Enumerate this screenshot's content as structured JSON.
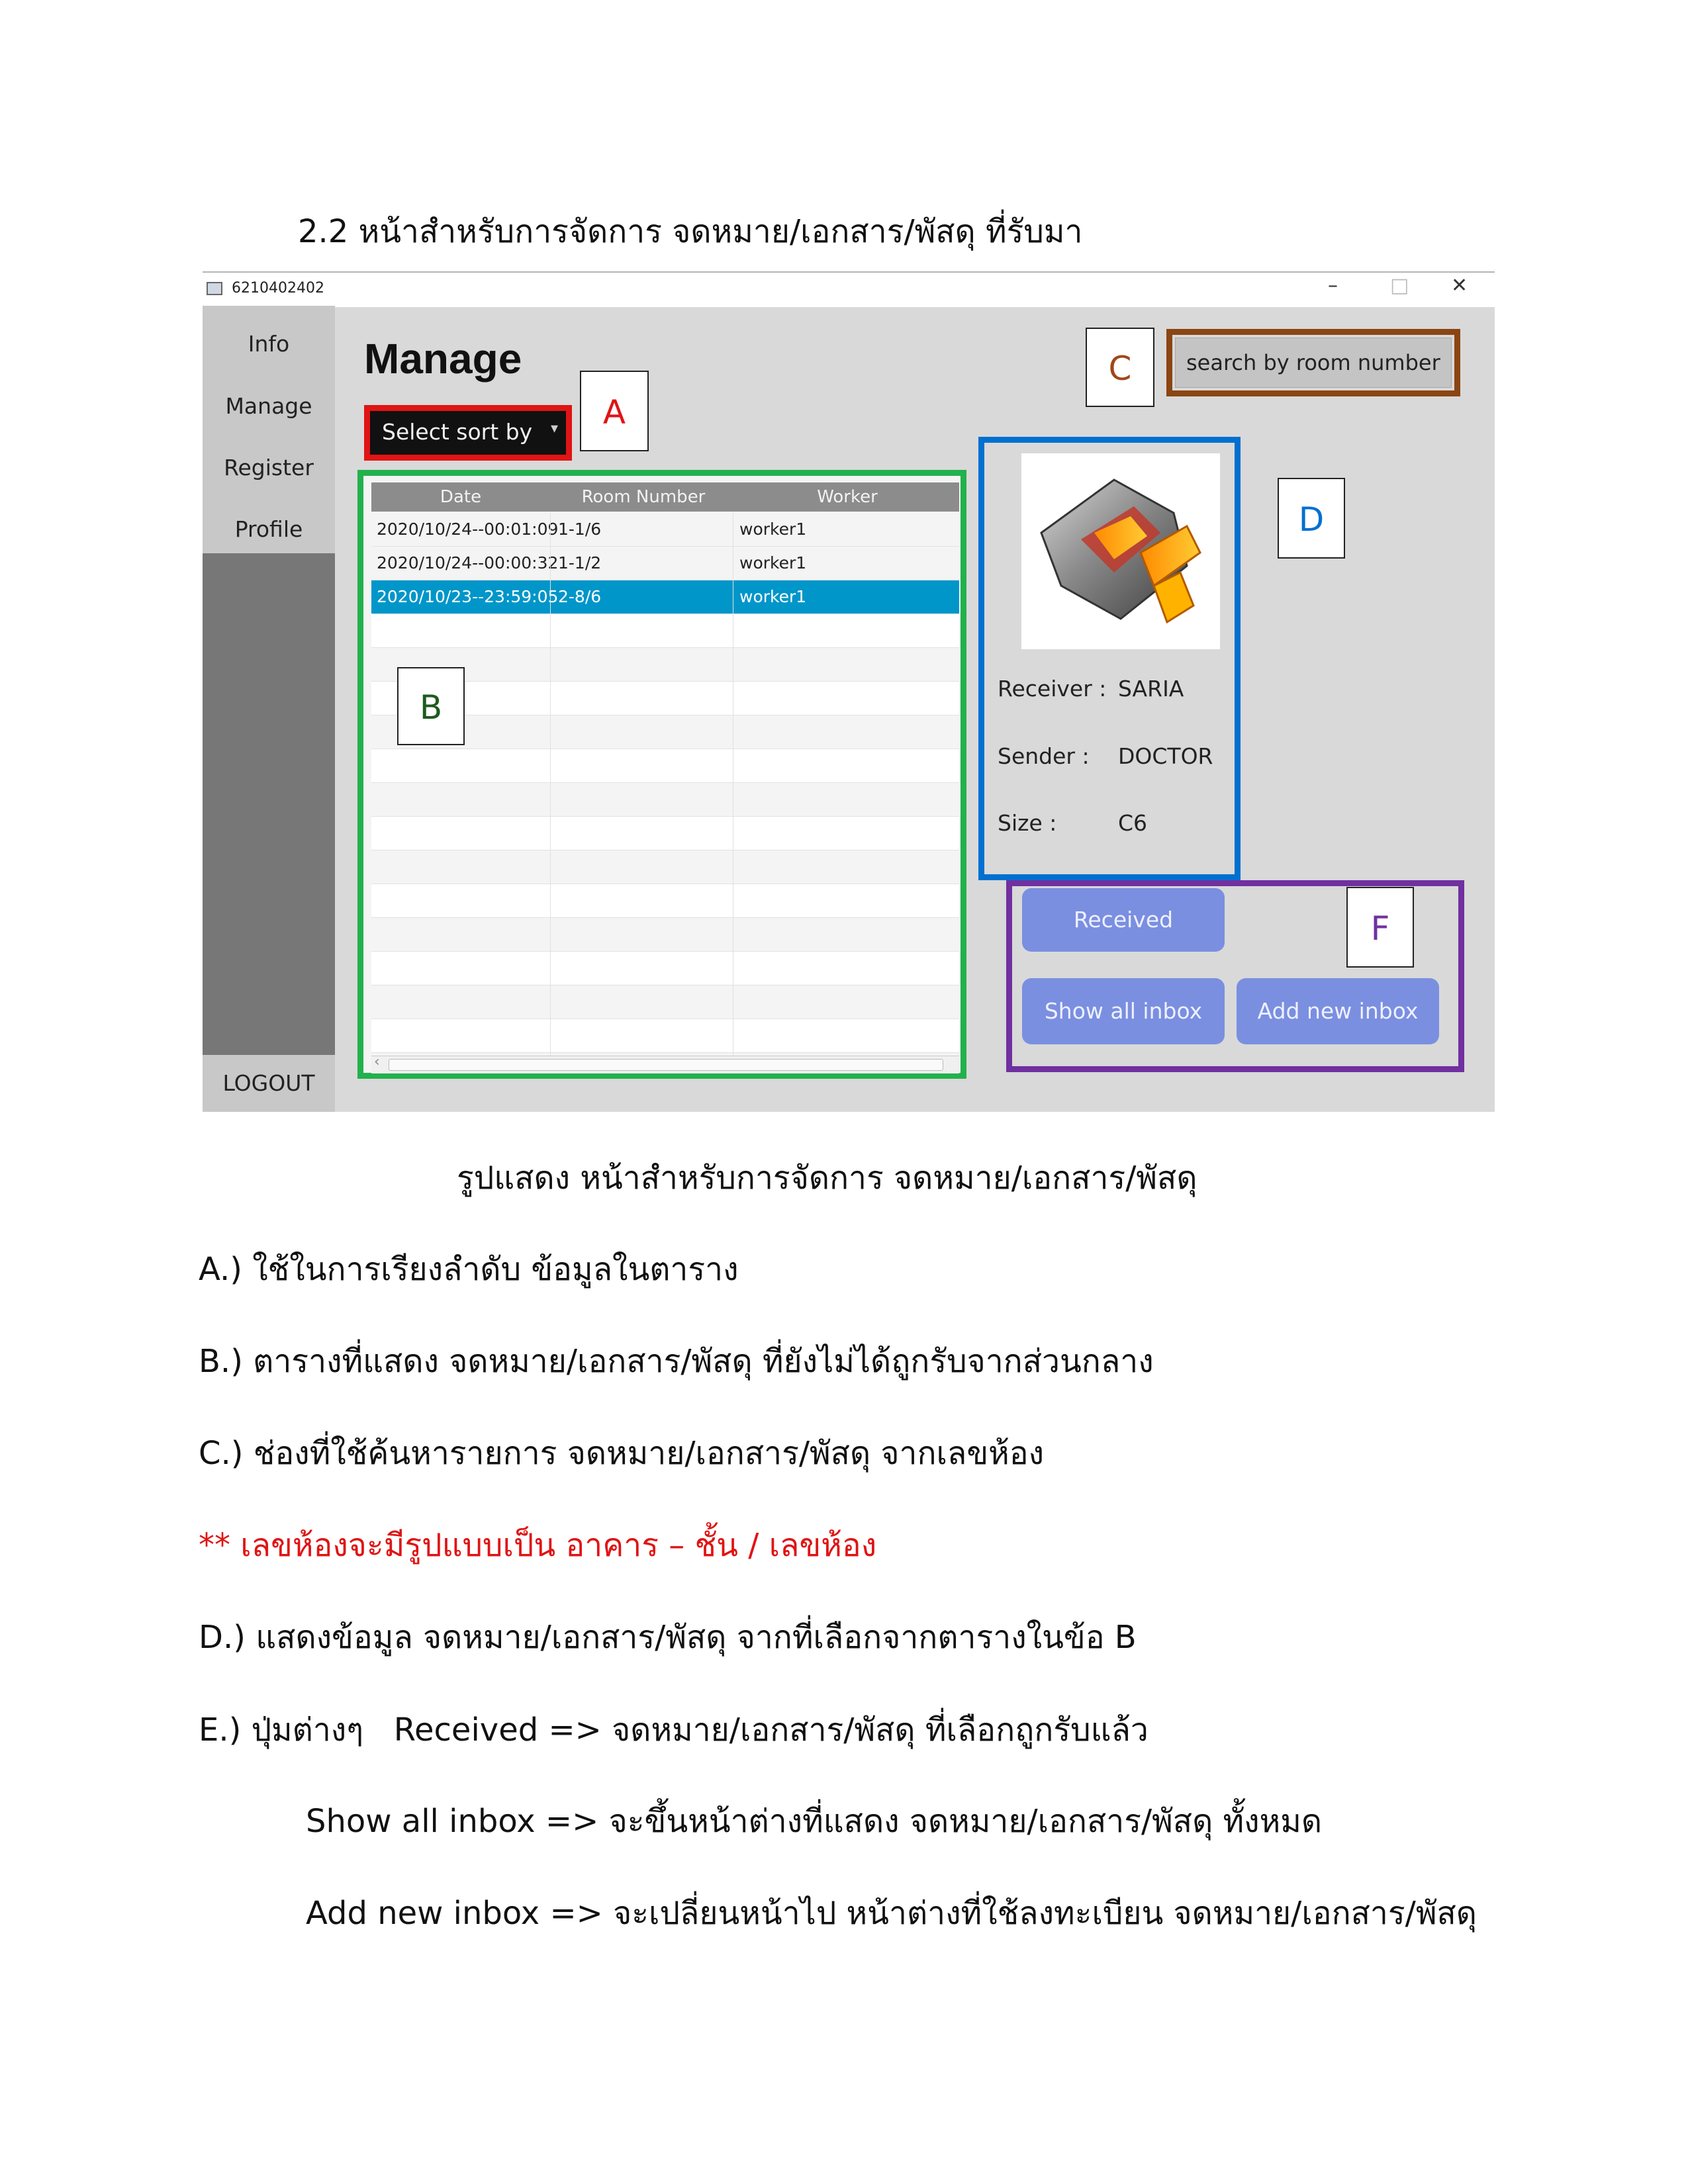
{
  "heading": "2.2 หน้าสำหรับการจัดการ จดหมาย/เอกสาร/พัสดุ ที่รับมา",
  "window": {
    "title": "6210402402",
    "controls": {
      "minimize": "–",
      "maximize": "□",
      "close": "✕"
    }
  },
  "sidebar": {
    "items": [
      {
        "label": "Info"
      },
      {
        "label": "Manage"
      },
      {
        "label": "Register"
      },
      {
        "label": "Profile"
      }
    ],
    "logout": "LOGOUT"
  },
  "main": {
    "title": "Manage",
    "sort_select": {
      "value": "Select sort by",
      "arrow": "▾"
    },
    "search": {
      "placeholder": "search by room number"
    },
    "table": {
      "columns": [
        "Date",
        "Room Number",
        "Worker"
      ],
      "rows": [
        {
          "date": "2020/10/24--00:01:09",
          "room": "1-1/6",
          "worker": "worker1",
          "selected": false
        },
        {
          "date": "2020/10/24--00:00:32",
          "room": "1-1/2",
          "worker": "worker1",
          "selected": false
        },
        {
          "date": "2020/10/23--23:59:05",
          "room": "2-8/6",
          "worker": "worker1",
          "selected": true
        }
      ],
      "scroll_left": "‹"
    },
    "details": {
      "receiver_label": "Receiver :",
      "receiver": "SARIA",
      "sender_label": "Sender :",
      "sender": "DOCTOR",
      "size_label": "Size :",
      "size": "C6"
    },
    "buttons": {
      "received": "Received",
      "show_all": "Show all inbox",
      "add_new": "Add new inbox"
    }
  },
  "callouts": {
    "a": "A",
    "b": "B",
    "c": "C",
    "d": "D",
    "f": "F"
  },
  "colors": {
    "callout_a_border": "#e01414",
    "callout_b_border": "#22b14c",
    "callout_c_border": "#8b4513",
    "callout_d_border": "#0070d0",
    "callout_f_border": "#7030a0",
    "selected_row": "#0096c9",
    "button": "#7a8fe0",
    "warning_text": "#e01414"
  },
  "caption": "รูปแสดง หน้าสำหรับการจัดการ จดหมาย/เอกสาร/พัสดุ",
  "notes": [
    "A.) ใช้ในการเรียงลำดับ ข้อมูลในตาราง",
    "B.) ตารางที่แสดง จดหมาย/เอกสาร/พัสดุ ที่ยังไม่ได้ถูกรับจากส่วนกลาง",
    "C.) ช่องที่ใช้ค้นหารายการ จดหมาย/เอกสาร/พัสดุ จากเลขห้อง",
    "** เลขห้องจะมีรูปแบบเป็น อาคาร – ชั้น / เลขห้อง",
    "D.) แสดงข้อมูล จดหมาย/เอกสาร/พัสดุ จากที่เลือกจากตารางในข้อ B",
    "E.) ปุ่มต่างๆ   Received => จดหมาย/เอกสาร/พัสดุ ที่เลือกถูกรับแล้ว",
    "Show all inbox => จะขึ้นหน้าต่างที่แสดง จดหมาย/เอกสาร/พัสดุ ทั้งหมด",
    "Add new inbox => จะเปลี่ยนหน้าไป หน้าต่างที่ใช้ลงทะเบียน จดหมาย/เอกสาร/พัสดุ"
  ]
}
